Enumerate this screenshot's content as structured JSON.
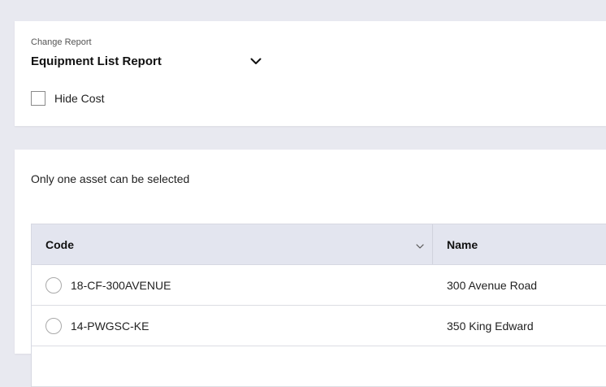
{
  "report": {
    "label": "Change Report",
    "selected": "Equipment List Report",
    "dropdown_icon": "chevron-down-icon"
  },
  "options": {
    "hide_cost_label": "Hide Cost",
    "hide_cost_checked": false
  },
  "selection_note": "Only one asset can be selected",
  "table": {
    "columns": [
      "Code",
      "Name"
    ],
    "sort_icon": "chevron-down-icon",
    "rows": [
      {
        "code": "18-CF-300AVENUE",
        "name": "300 Avenue Road",
        "selected": false
      },
      {
        "code": "14-PWGSC-KE",
        "name": "350 King Edward",
        "selected": false
      }
    ]
  }
}
